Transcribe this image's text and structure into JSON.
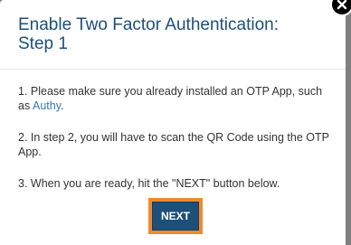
{
  "modal": {
    "title": "Enable Two Factor Authentication: Step 1",
    "step1_text": "1. Please make sure you already installed an OTP App, such as",
    "step1_link": "Authy",
    "step1_end": ".",
    "step2_text": "2. In step 2, you will have to scan the QR Code using the OTP App.",
    "step3_text": "3. When you are ready, hit the \"NEXT\" button below.",
    "next_label": "NEXT",
    "close_icon": "close-icon"
  },
  "colors": {
    "title": "#1e4e79",
    "link": "#337ab7",
    "button": "#1c4f7a",
    "button_highlight": "#ee8a2f",
    "backdrop": "#7f7f7f"
  }
}
